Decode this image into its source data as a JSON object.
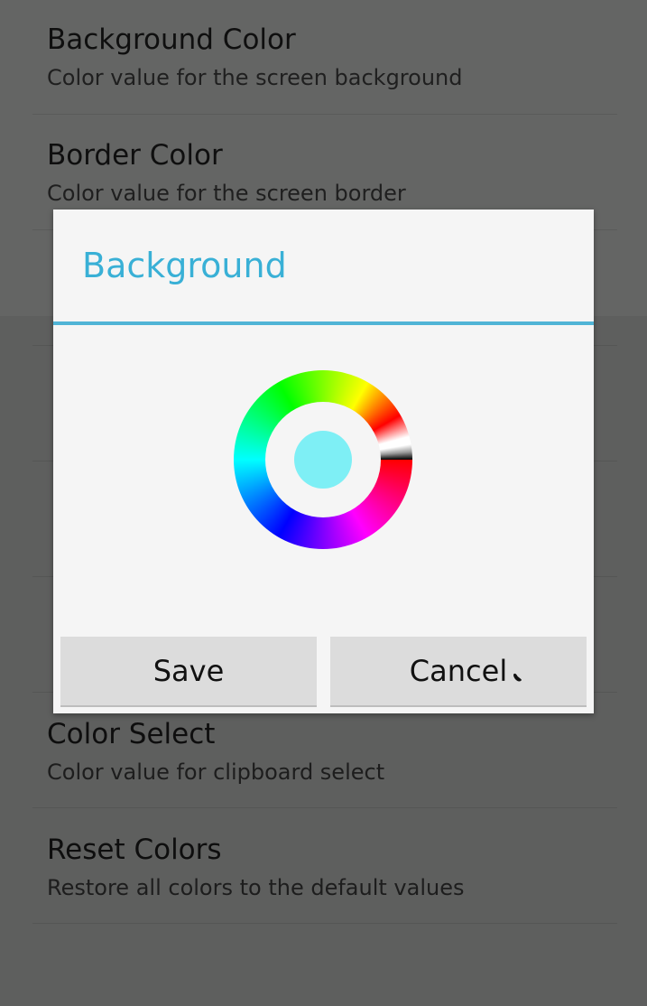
{
  "preferences": [
    {
      "title": "Background Color",
      "summary": "Color value for the screen background"
    },
    {
      "title": "Border Color",
      "summary": "Color value for the screen border"
    },
    {
      "title": "",
      "summary": ""
    },
    {
      "title": "",
      "summary": ""
    },
    {
      "title": "",
      "summary": ""
    },
    {
      "title": "",
      "summary": ""
    },
    {
      "title": "Color Select",
      "summary": "Color value for clipboard select"
    },
    {
      "title": "Reset Colors",
      "summary": "Restore all colors to the default values"
    }
  ],
  "dialog": {
    "title": "Background",
    "selected_color": "#7eeff5",
    "save_label": "Save",
    "cancel_label": "Cancel"
  },
  "colors": {
    "accent": "#39b0d6",
    "dialog_background": "#f5f5f5",
    "button_background": "#dcdcdc",
    "screen_dim": "#646564"
  },
  "icons": {
    "color_wheel": "color-wheel-icon",
    "pointer": "touch-pointer-icon"
  }
}
